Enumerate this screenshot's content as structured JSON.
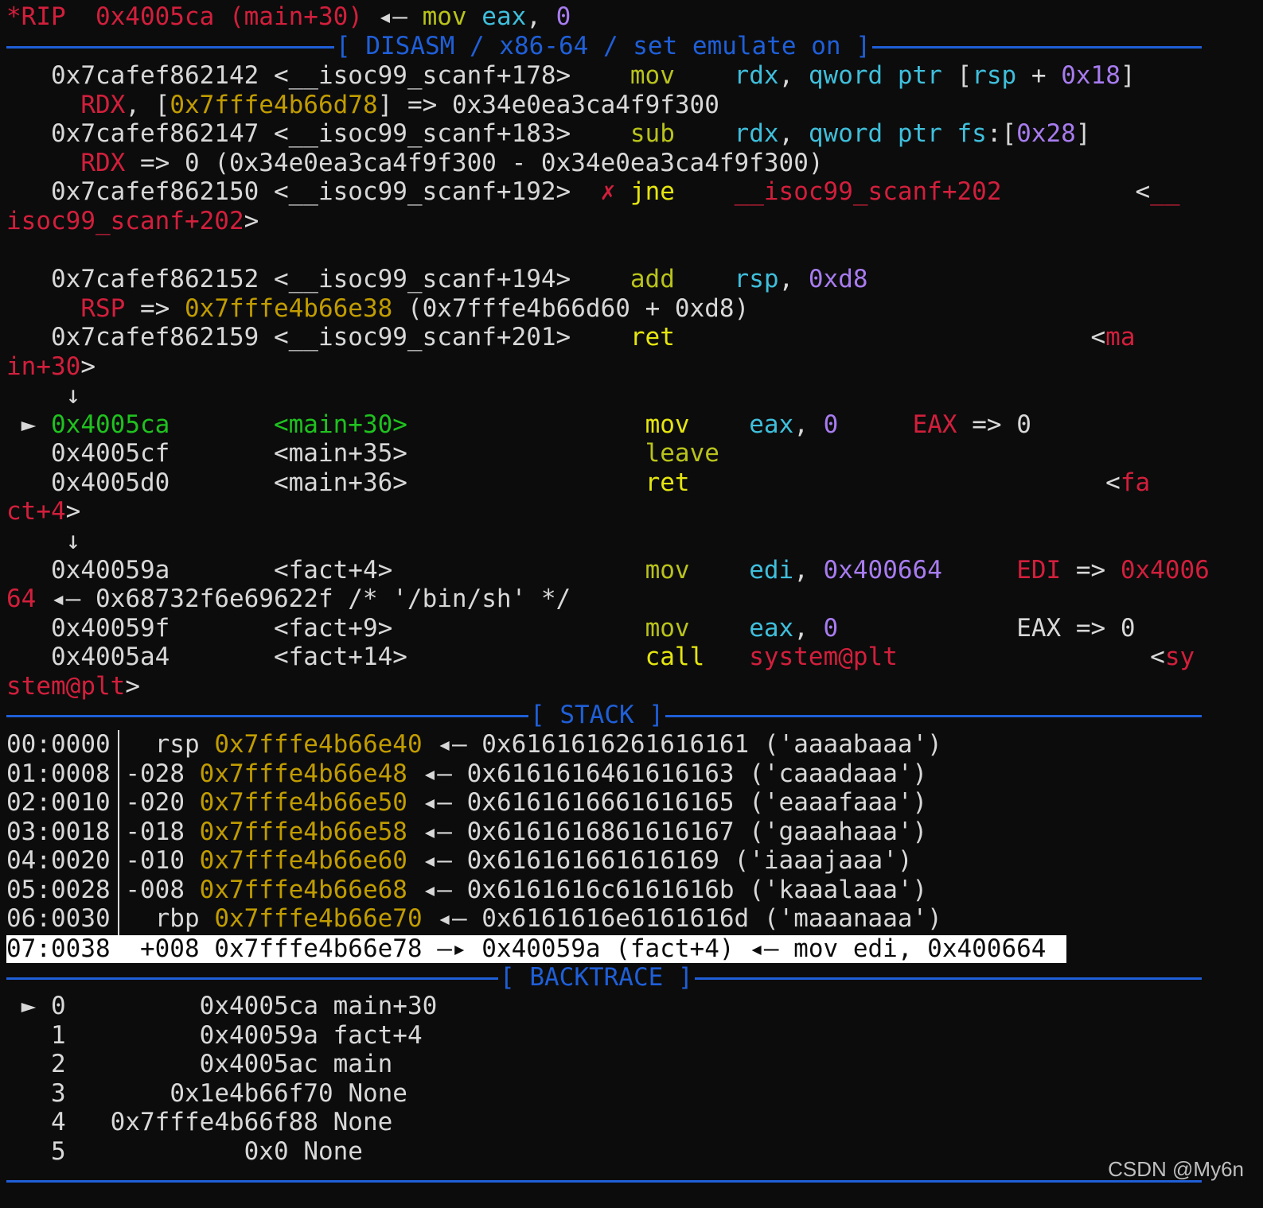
{
  "window": {
    "watermark": "CSDN @My6n"
  },
  "rip": {
    "label": "*RIP",
    "addr": "0x4005ca (main+30)",
    "arrow": "◂—",
    "mov": "mov",
    "reg": "eax",
    "comma": ",",
    "imm": "0"
  },
  "sections": {
    "disasm": "[ DISASM / x86-64 / set emulate on ]",
    "stack": "[ STACK ]",
    "backtrace": "[ BACKTRACE ]"
  },
  "disasm": {
    "l1_addr": "0x7cafef862142 <__isoc99_scanf+178>",
    "l1_mn": "mov",
    "l1_op1": "rdx",
    "l1_op2": "qword ptr",
    "l1_br": "[",
    "l1_reg": "rsp",
    "l1_plus": "+",
    "l1_imm": "0x18",
    "l1_end": "]",
    "l2_reg": "RDX",
    "l2_a": ", [",
    "l2_addr": "0x7fffe4b66d78",
    "l2_b": "] => 0x34e0ea3ca4f9f300",
    "l3_addr": "0x7cafef862147 <__isoc99_scanf+183>",
    "l3_mn": "sub",
    "l3_op1": "rdx",
    "l3_op2": "qword ptr fs",
    "l3_c": ":[",
    "l3_imm": "0x28",
    "l3_end": "]",
    "l4_reg": "RDX",
    "l4_rest": "=> 0 (0x34e0ea3ca4f9f300 - 0x34e0ea3ca4f9f300)",
    "l5_addr": "0x7cafef862150 <__isoc99_scanf+192>",
    "l5_x": "✗",
    "l5_mn": "jne",
    "l5_target": "__isoc99_scanf+202",
    "l5_lt": "<",
    "l5_tail": "__",
    "l6_wrap": "isoc99_scanf+202",
    "l6_gt": ">",
    "l7_addr": "0x7cafef862152 <__isoc99_scanf+194>",
    "l7_mn": "add",
    "l7_op1": "rsp",
    "l7_imm": "0xd8",
    "l8_reg": "RSP",
    "l8_arrow": "=>",
    "l8_val": "0x7fffe4b66e38",
    "l8_rest": "(0x7fffe4b66d60 + 0xd8)",
    "l9_addr": "0x7cafef862159 <__isoc99_scanf+201>",
    "l9_mn": "ret",
    "l9_lt": "<",
    "l9_tail": "ma",
    "l10_wrap": "in+30",
    "l10_gt": ">",
    "down1": "↓",
    "cur_mark": "►",
    "cur_addr": "0x4005ca",
    "cur_sym": "<main+30>",
    "cur_mn": "mov",
    "cur_op1": "eax",
    "cur_imm": "0",
    "cur_note_reg": "EAX",
    "cur_note_rest": "=> 0",
    "l12_addr": "0x4005cf",
    "l12_sym": "<main+35>",
    "l12_mn": "leave",
    "l13_addr": "0x4005d0",
    "l13_sym": "<main+36>",
    "l13_mn": "ret",
    "l13_lt": "<",
    "l13_tail": "fa",
    "l14_wrap": "ct+4",
    "l14_gt": ">",
    "down2": "↓",
    "l15_addr": "0x40059a",
    "l15_sym": "<fact+4>",
    "l15_mn": "mov",
    "l15_op1": "edi",
    "l15_imm": "0x400664",
    "l15_note_reg": "EDI",
    "l15_note_arrow": "=>",
    "l15_note_val": "0x4006",
    "l16_wrap": "64",
    "l16_rest": "◂— 0x68732f6e69622f /* '/bin/sh' */",
    "l17_addr": "0x40059f",
    "l17_sym": "<fact+9>",
    "l17_mn": "mov",
    "l17_op1": "eax",
    "l17_imm": "0",
    "l17_note": "EAX => 0",
    "l18_addr": "0x4005a4",
    "l18_sym": "<fact+14>",
    "l18_mn": "call",
    "l18_target": "system@plt",
    "l18_lt": "<",
    "l18_tail": "sy",
    "l19_wrap": "stem@plt",
    "l19_gt": ">"
  },
  "stack": [
    {
      "idx": "00:0000",
      "off": " rsp",
      "addr": "0x7fffe4b66e40",
      "val": "◂— 0x6161616261616161 ('aaaabaaa')"
    },
    {
      "idx": "01:0008",
      "off": "-028",
      "addr": "0x7fffe4b66e48",
      "val": "◂— 0x6161616461616163 ('caaadaaa')"
    },
    {
      "idx": "02:0010",
      "off": "-020",
      "addr": "0x7fffe4b66e50",
      "val": "◂— 0x6161616661616165 ('eaaafaaa')"
    },
    {
      "idx": "03:0018",
      "off": "-018",
      "addr": "0x7fffe4b66e58",
      "val": "◂— 0x6161616861616167 ('gaaahaaa')"
    },
    {
      "idx": "04:0020",
      "off": "-010",
      "addr": "0x7fffe4b66e60",
      "val": "◂— 0x616161661616169 ('iaaajaaa')"
    },
    {
      "idx": "05:0028",
      "off": "-008",
      "addr": "0x7fffe4b66e68",
      "val": "◂— 0x6161616c6161616b ('kaaalaaa')"
    },
    {
      "idx": "06:0030",
      "off": " rbp",
      "addr": "0x7fffe4b66e70",
      "val": "◂— 0x6161616e6161616d ('maaanaaa')"
    }
  ],
  "stack_selected": {
    "idx": "07:0038",
    "text": "+008 0x7fffe4b66e78 —▸ 0x40059a (fact+4) ◂— mov edi, 0x400664"
  },
  "backtrace": [
    {
      "mark": "►",
      "n": "0",
      "addr": "0x4005ca",
      "sym": "main+30"
    },
    {
      "mark": "",
      "n": "1",
      "addr": "0x40059a",
      "sym": "fact+4"
    },
    {
      "mark": "",
      "n": "2",
      "addr": "0x4005ac",
      "sym": "main"
    },
    {
      "mark": "",
      "n": "3",
      "addr": "0x1e4b66f70",
      "sym": "None"
    },
    {
      "mark": "",
      "n": "4",
      "addr": "0x7fffe4b66f88",
      "sym": "None"
    },
    {
      "mark": "",
      "n": "5",
      "addr": "0x0",
      "sym": "None"
    }
  ]
}
